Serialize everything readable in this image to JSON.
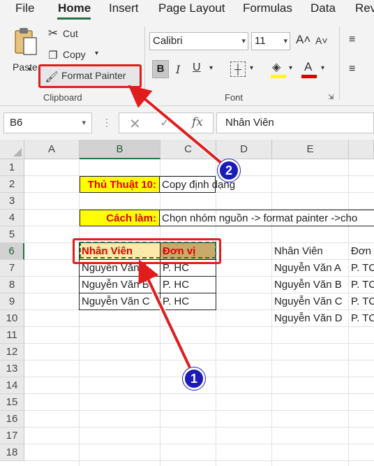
{
  "ribbon_tabs": {
    "file": "File",
    "home": "Home",
    "insert": "Insert",
    "page_layout": "Page Layout",
    "formulas": "Formulas",
    "data": "Data",
    "review": "Rev"
  },
  "clipboard": {
    "paste": "Paste",
    "cut": "Cut",
    "copy": "Copy",
    "format_painter": "Format Painter",
    "group_label": "Clipboard"
  },
  "font": {
    "name": "Calibri",
    "size": "11",
    "bold": "B",
    "italic": "I",
    "underline": "U",
    "font_color_letter": "A",
    "grow_font": "A˄",
    "shrink_font": "A˅",
    "group_label": "Font",
    "fill_color": "#ffff00",
    "text_color": "#e00000"
  },
  "formula_bar": {
    "name_box": "B6",
    "fx": "fx",
    "content": "Nhân Viên"
  },
  "columns": [
    "A",
    "B",
    "C",
    "D",
    "E"
  ],
  "rows": [
    "1",
    "2",
    "3",
    "4",
    "5",
    "6",
    "7",
    "8",
    "9",
    "10",
    "11",
    "12",
    "13",
    "14",
    "15",
    "16",
    "17",
    "18"
  ],
  "sheet": {
    "b2": "Thủ Thuật 10:",
    "c2": "Copy định dạng",
    "b4": "Cách làm:",
    "c4": "Chọn nhóm nguồn -> format painter ->cho",
    "b6": "Nhân Viên",
    "c6": "Đơn vị",
    "b7": "Nguyễn Văn A",
    "c7": "P. HC",
    "b8": "Nguyễn Văn B",
    "c8": "P. HC",
    "b9": "Nguyễn Văn C",
    "c9": "P. HC",
    "e6": "Nhân Viên",
    "f6": "Đơn",
    "e7": "Nguyễn Văn A",
    "f7": "P. TC",
    "e8": "Nguyễn Văn B",
    "f8": "P. TC",
    "e9": "Nguyễn Văn C",
    "f9": "P. TC",
    "e10": "Nguyễn Văn D",
    "f10": "P. TC"
  },
  "annotations": {
    "step1": "1",
    "step2": "2",
    "highlight_color": "#e11c1c",
    "badge_color": "#1b1bb8"
  },
  "colors": {
    "accent": "#217346",
    "header_fill_b6": "#fde9a9",
    "header_fill_c6": "#c9aa6b",
    "label_fill": "#ffff00"
  }
}
